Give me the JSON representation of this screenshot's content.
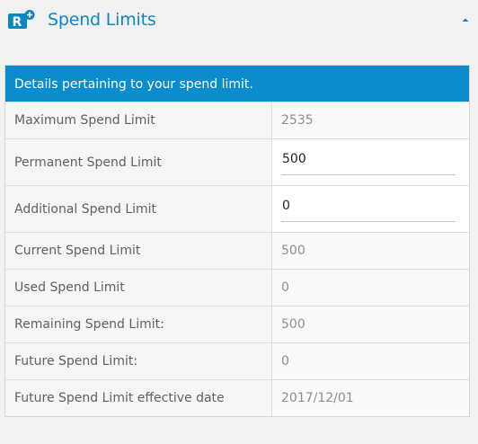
{
  "header": {
    "title": "Spend Limits",
    "logo_letter": "R",
    "accent_color": "#0b87c6"
  },
  "panel": {
    "heading": "Details pertaining to your spend limit.",
    "heading_bg": "#0b8ccd",
    "rows": [
      {
        "label": "Maximum Spend Limit",
        "value": "2535"
      },
      {
        "label": "Permanent Spend Limit",
        "value": "500"
      },
      {
        "label": "Additional Spend Limit",
        "value": "0"
      },
      {
        "label": "Current Spend Limit",
        "value": "500"
      },
      {
        "label": "Used Spend Limit",
        "value": "0"
      },
      {
        "label": "Remaining Spend Limit:",
        "value": "500"
      },
      {
        "label": "Future Spend Limit:",
        "value": "0"
      },
      {
        "label": "Future Spend Limit effective date",
        "value": "2017/12/01"
      }
    ]
  }
}
